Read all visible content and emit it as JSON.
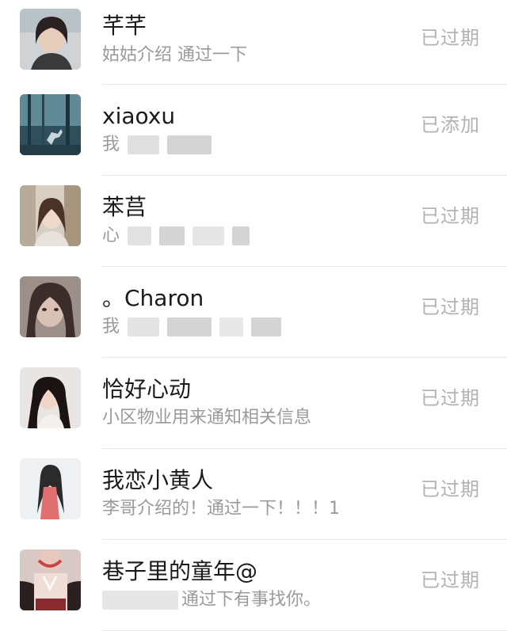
{
  "contacts": [
    {
      "name": "芊芊",
      "message": "姑姑介绍 通过一下",
      "status": "已过期"
    },
    {
      "name": "xiaoxu",
      "message": "我",
      "status": "已添加"
    },
    {
      "name": "苯莒",
      "message": "心",
      "status": "已过期"
    },
    {
      "name": "。Charon",
      "message": "我",
      "status": "已过期"
    },
    {
      "name": "恰好心动",
      "message": "小区物业用来通知相关信息",
      "status": "已过期"
    },
    {
      "name": "我恋小黄人",
      "message": "李哥介绍的！通过一下！！！1",
      "status": "已过期"
    },
    {
      "name": "巷子里的童年@",
      "message": "通过下有事找你。",
      "status": "已过期"
    }
  ],
  "colors": {
    "name_text": "#1a1a1a",
    "message_text": "#9a9a9a",
    "status_text": "#b3b3b3",
    "divider": "#e6e6e6"
  }
}
